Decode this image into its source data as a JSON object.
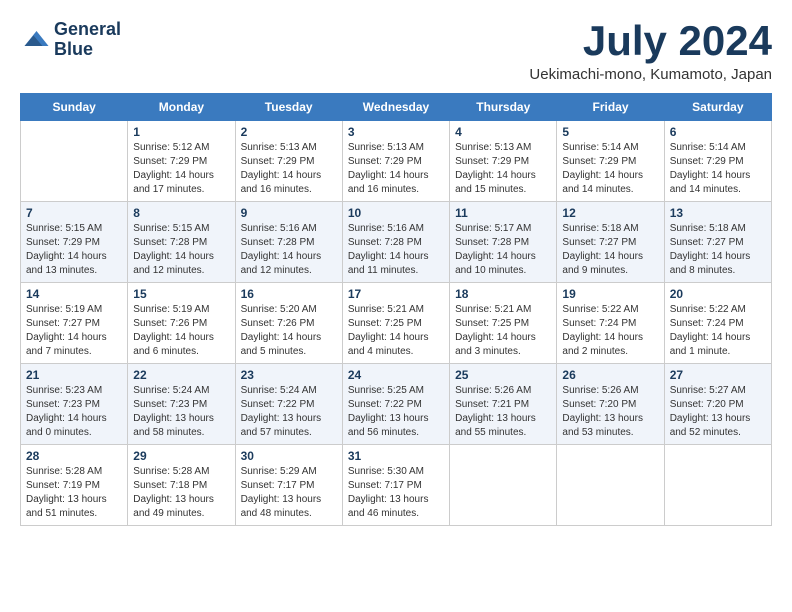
{
  "logo": {
    "line1": "General",
    "line2": "Blue"
  },
  "title": "July 2024",
  "location": "Uekimachi-mono, Kumamoto, Japan",
  "days_of_week": [
    "Sunday",
    "Monday",
    "Tuesday",
    "Wednesday",
    "Thursday",
    "Friday",
    "Saturday"
  ],
  "weeks": [
    [
      {
        "day": "",
        "info": ""
      },
      {
        "day": "1",
        "info": "Sunrise: 5:12 AM\nSunset: 7:29 PM\nDaylight: 14 hours\nand 17 minutes."
      },
      {
        "day": "2",
        "info": "Sunrise: 5:13 AM\nSunset: 7:29 PM\nDaylight: 14 hours\nand 16 minutes."
      },
      {
        "day": "3",
        "info": "Sunrise: 5:13 AM\nSunset: 7:29 PM\nDaylight: 14 hours\nand 16 minutes."
      },
      {
        "day": "4",
        "info": "Sunrise: 5:13 AM\nSunset: 7:29 PM\nDaylight: 14 hours\nand 15 minutes."
      },
      {
        "day": "5",
        "info": "Sunrise: 5:14 AM\nSunset: 7:29 PM\nDaylight: 14 hours\nand 14 minutes."
      },
      {
        "day": "6",
        "info": "Sunrise: 5:14 AM\nSunset: 7:29 PM\nDaylight: 14 hours\nand 14 minutes."
      }
    ],
    [
      {
        "day": "7",
        "info": "Sunrise: 5:15 AM\nSunset: 7:29 PM\nDaylight: 14 hours\nand 13 minutes."
      },
      {
        "day": "8",
        "info": "Sunrise: 5:15 AM\nSunset: 7:28 PM\nDaylight: 14 hours\nand 12 minutes."
      },
      {
        "day": "9",
        "info": "Sunrise: 5:16 AM\nSunset: 7:28 PM\nDaylight: 14 hours\nand 12 minutes."
      },
      {
        "day": "10",
        "info": "Sunrise: 5:16 AM\nSunset: 7:28 PM\nDaylight: 14 hours\nand 11 minutes."
      },
      {
        "day": "11",
        "info": "Sunrise: 5:17 AM\nSunset: 7:28 PM\nDaylight: 14 hours\nand 10 minutes."
      },
      {
        "day": "12",
        "info": "Sunrise: 5:18 AM\nSunset: 7:27 PM\nDaylight: 14 hours\nand 9 minutes."
      },
      {
        "day": "13",
        "info": "Sunrise: 5:18 AM\nSunset: 7:27 PM\nDaylight: 14 hours\nand 8 minutes."
      }
    ],
    [
      {
        "day": "14",
        "info": "Sunrise: 5:19 AM\nSunset: 7:27 PM\nDaylight: 14 hours\nand 7 minutes."
      },
      {
        "day": "15",
        "info": "Sunrise: 5:19 AM\nSunset: 7:26 PM\nDaylight: 14 hours\nand 6 minutes."
      },
      {
        "day": "16",
        "info": "Sunrise: 5:20 AM\nSunset: 7:26 PM\nDaylight: 14 hours\nand 5 minutes."
      },
      {
        "day": "17",
        "info": "Sunrise: 5:21 AM\nSunset: 7:25 PM\nDaylight: 14 hours\nand 4 minutes."
      },
      {
        "day": "18",
        "info": "Sunrise: 5:21 AM\nSunset: 7:25 PM\nDaylight: 14 hours\nand 3 minutes."
      },
      {
        "day": "19",
        "info": "Sunrise: 5:22 AM\nSunset: 7:24 PM\nDaylight: 14 hours\nand 2 minutes."
      },
      {
        "day": "20",
        "info": "Sunrise: 5:22 AM\nSunset: 7:24 PM\nDaylight: 14 hours\nand 1 minute."
      }
    ],
    [
      {
        "day": "21",
        "info": "Sunrise: 5:23 AM\nSunset: 7:23 PM\nDaylight: 14 hours\nand 0 minutes."
      },
      {
        "day": "22",
        "info": "Sunrise: 5:24 AM\nSunset: 7:23 PM\nDaylight: 13 hours\nand 58 minutes."
      },
      {
        "day": "23",
        "info": "Sunrise: 5:24 AM\nSunset: 7:22 PM\nDaylight: 13 hours\nand 57 minutes."
      },
      {
        "day": "24",
        "info": "Sunrise: 5:25 AM\nSunset: 7:22 PM\nDaylight: 13 hours\nand 56 minutes."
      },
      {
        "day": "25",
        "info": "Sunrise: 5:26 AM\nSunset: 7:21 PM\nDaylight: 13 hours\nand 55 minutes."
      },
      {
        "day": "26",
        "info": "Sunrise: 5:26 AM\nSunset: 7:20 PM\nDaylight: 13 hours\nand 53 minutes."
      },
      {
        "day": "27",
        "info": "Sunrise: 5:27 AM\nSunset: 7:20 PM\nDaylight: 13 hours\nand 52 minutes."
      }
    ],
    [
      {
        "day": "28",
        "info": "Sunrise: 5:28 AM\nSunset: 7:19 PM\nDaylight: 13 hours\nand 51 minutes."
      },
      {
        "day": "29",
        "info": "Sunrise: 5:28 AM\nSunset: 7:18 PM\nDaylight: 13 hours\nand 49 minutes."
      },
      {
        "day": "30",
        "info": "Sunrise: 5:29 AM\nSunset: 7:17 PM\nDaylight: 13 hours\nand 48 minutes."
      },
      {
        "day": "31",
        "info": "Sunrise: 5:30 AM\nSunset: 7:17 PM\nDaylight: 13 hours\nand 46 minutes."
      },
      {
        "day": "",
        "info": ""
      },
      {
        "day": "",
        "info": ""
      },
      {
        "day": "",
        "info": ""
      }
    ]
  ]
}
